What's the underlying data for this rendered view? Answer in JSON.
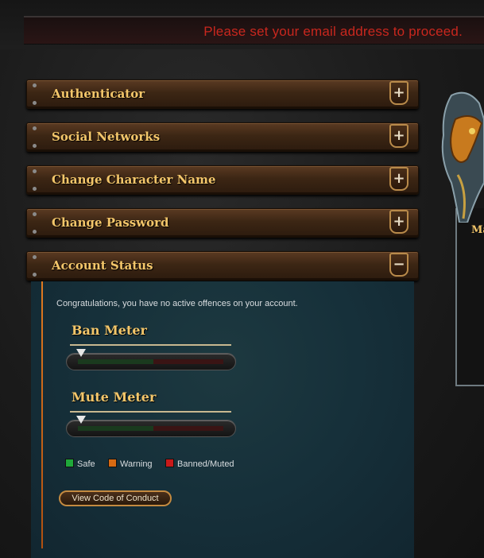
{
  "notice": {
    "text": "Please set your email address to proceed."
  },
  "accordion": {
    "items": [
      {
        "label": "Authenticator",
        "toggle": "+"
      },
      {
        "label": "Social Networks",
        "toggle": "+"
      },
      {
        "label": "Change Character Name",
        "toggle": "+"
      },
      {
        "label": "Change Password",
        "toggle": "+"
      },
      {
        "label": "Account Status",
        "toggle": "−"
      }
    ]
  },
  "account_status": {
    "message": "Congratulations, you have no active offences on your account.",
    "ban_meter": {
      "title": "Ban Meter",
      "value": 0
    },
    "mute_meter": {
      "title": "Mute Meter",
      "value": 0
    },
    "legend": {
      "safe": "Safe",
      "warning": "Warning",
      "banned": "Banned/Muted"
    },
    "conduct_button": "View Code of Conduct"
  },
  "colors": {
    "safe": "#1fa83a",
    "warning": "#d86a12",
    "banned": "#c81a1a",
    "accent": "#f3c66a"
  },
  "side_frame": {
    "label": "Ma"
  }
}
